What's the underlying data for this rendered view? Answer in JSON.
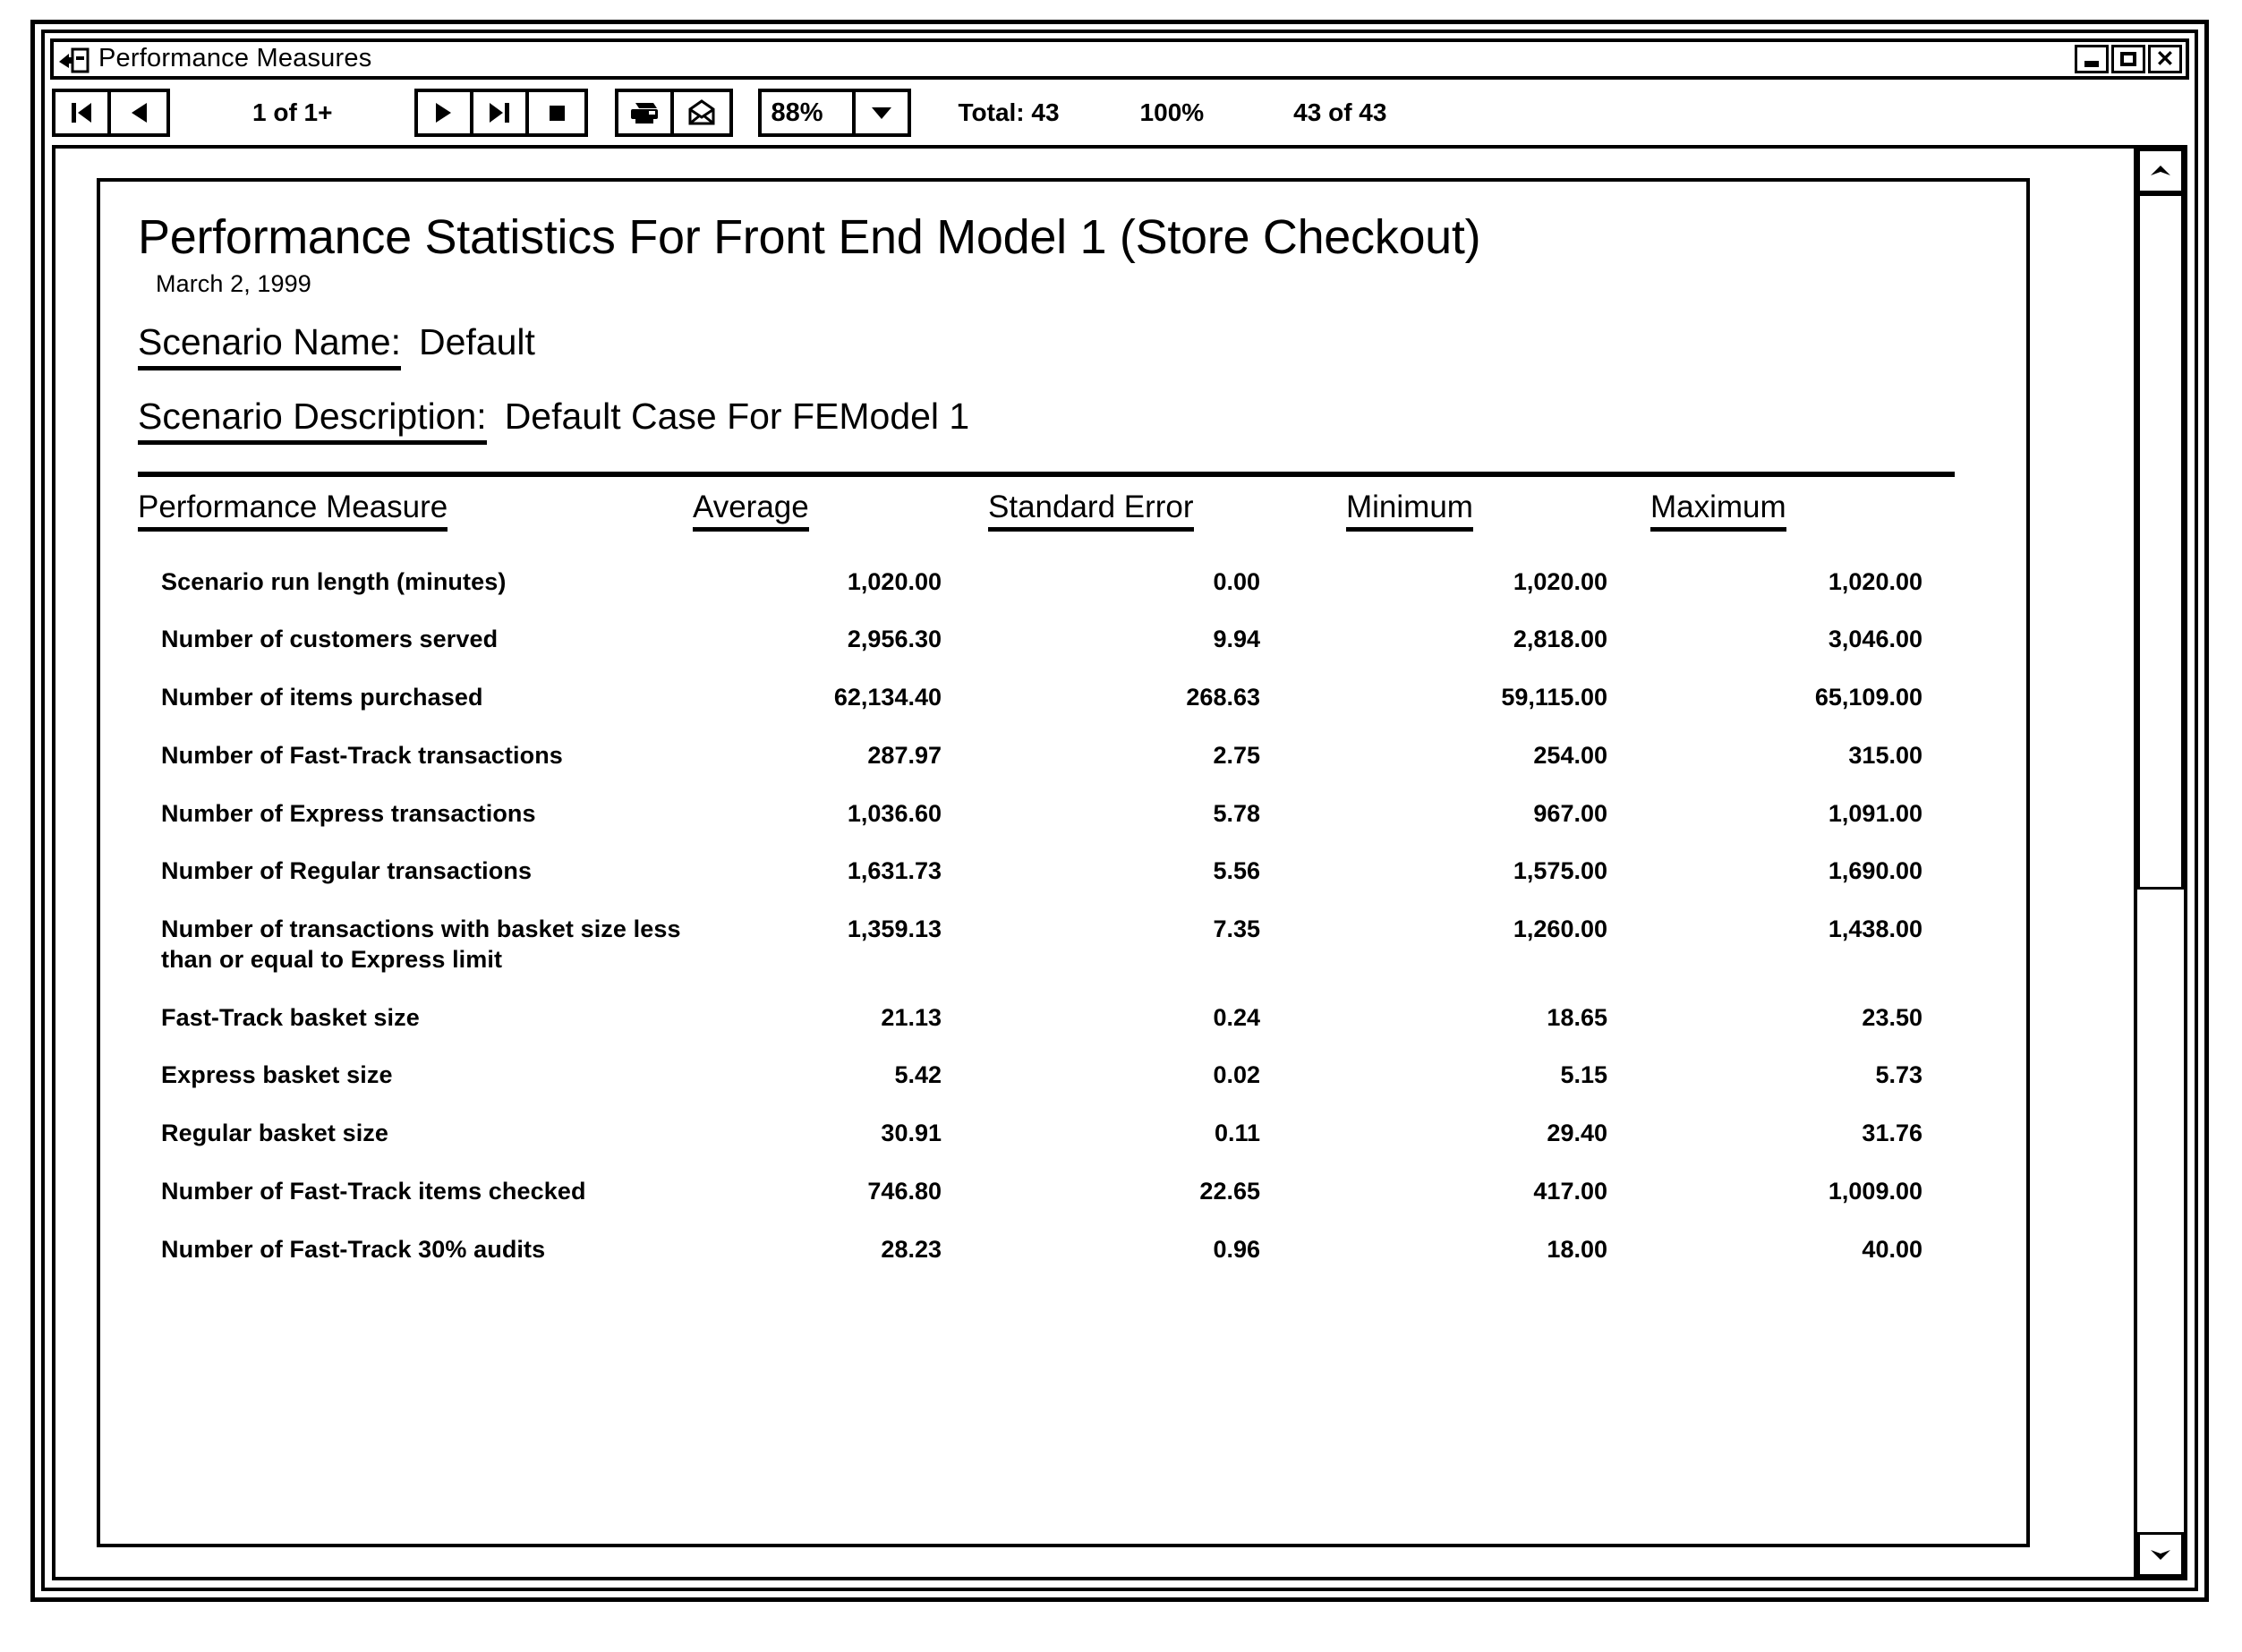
{
  "window": {
    "title": "Performance Measures",
    "icon": "report-preview-icon",
    "minimize_label": "Minimize",
    "maximize_label": "Maximize",
    "close_label": "✕"
  },
  "toolbar": {
    "first_page_label": "first-page",
    "prev_page_label": "previous-page",
    "page_indicator": "1 of 1+",
    "next_page_label": "next-page",
    "last_page_label": "last-page",
    "stop_label": "stop",
    "print_label": "print",
    "mail_label": "mail",
    "zoom_value": "88%",
    "zoom_arrow": "▼",
    "total_label": "Total: 43",
    "percent_label": "100%",
    "records_label": "43 of 43"
  },
  "report": {
    "title": "Performance Statistics For Front End Model 1 (Store Checkout)",
    "date": "March 2, 1999",
    "scenario_name_label": "Scenario Name:",
    "scenario_name_value": "Default",
    "scenario_desc_label": "Scenario Description:",
    "scenario_desc_value": "Default Case For FEModel 1"
  },
  "table": {
    "headers": {
      "measure": "Performance Measure",
      "average": "Average",
      "standard_error": "Standard Error",
      "minimum": "Minimum",
      "maximum": "Maximum"
    },
    "rows": [
      {
        "measure": "Scenario run length (minutes)",
        "average": "1,020.00",
        "standard_error": "0.00",
        "minimum": "1,020.00",
        "maximum": "1,020.00"
      },
      {
        "measure": "Number of customers served",
        "average": "2,956.30",
        "standard_error": "9.94",
        "minimum": "2,818.00",
        "maximum": "3,046.00"
      },
      {
        "measure": "Number of items purchased",
        "average": "62,134.40",
        "standard_error": "268.63",
        "minimum": "59,115.00",
        "maximum": "65,109.00"
      },
      {
        "measure": "Number of Fast-Track transactions",
        "average": "287.97",
        "standard_error": "2.75",
        "minimum": "254.00",
        "maximum": "315.00"
      },
      {
        "measure": "Number of Express transactions",
        "average": "1,036.60",
        "standard_error": "5.78",
        "minimum": "967.00",
        "maximum": "1,091.00"
      },
      {
        "measure": "Number of Regular transactions",
        "average": "1,631.73",
        "standard_error": "5.56",
        "minimum": "1,575.00",
        "maximum": "1,690.00"
      },
      {
        "measure": "Number of transactions with basket size less than or equal to Express limit",
        "average": "1,359.13",
        "standard_error": "7.35",
        "minimum": "1,260.00",
        "maximum": "1,438.00"
      },
      {
        "measure": "Fast-Track basket size",
        "average": "21.13",
        "standard_error": "0.24",
        "minimum": "18.65",
        "maximum": "23.50"
      },
      {
        "measure": "Express basket size",
        "average": "5.42",
        "standard_error": "0.02",
        "minimum": "5.15",
        "maximum": "5.73"
      },
      {
        "measure": "Regular basket size",
        "average": "30.91",
        "standard_error": "0.11",
        "minimum": "29.40",
        "maximum": "31.76"
      },
      {
        "measure": "Number of Fast-Track items checked",
        "average": "746.80",
        "standard_error": "22.65",
        "minimum": "417.00",
        "maximum": "1,009.00"
      },
      {
        "measure": "Number of Fast-Track 30% audits",
        "average": "28.23",
        "standard_error": "0.96",
        "minimum": "18.00",
        "maximum": "40.00"
      }
    ]
  },
  "scrollbar": {
    "up_arrow": "▲",
    "down_arrow": "▼",
    "thumb_position_percent": 0,
    "thumb_size_percent": 52
  },
  "colors": {
    "ink": "#000000",
    "paper": "#ffffff"
  }
}
